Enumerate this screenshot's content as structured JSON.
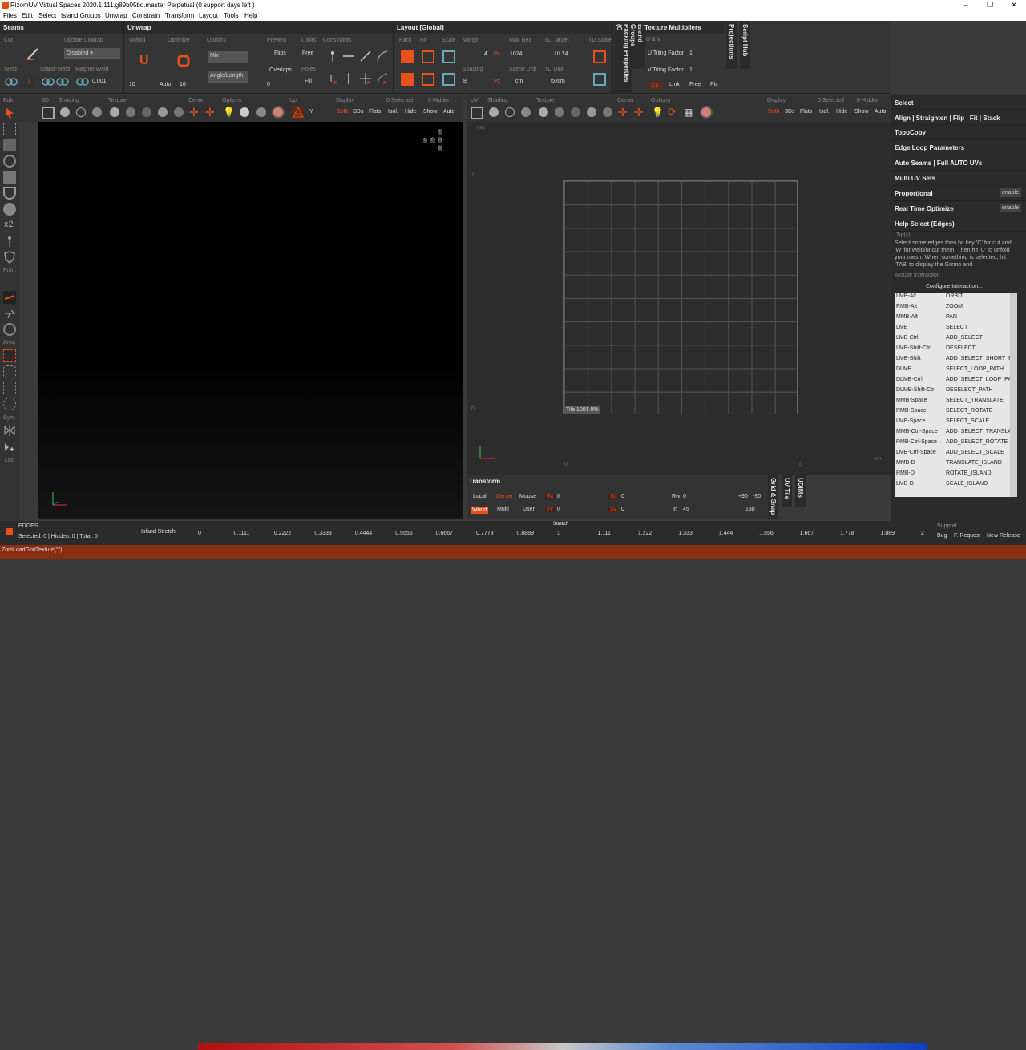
{
  "title": "RizomUV  Virtual Spaces 2020.1.111.g89b05bd.master Perpetual  (0 support days left )",
  "menu": [
    "Files",
    "Edit",
    "Select",
    "Island Groups",
    "Unwrap",
    "Constrain",
    "Transform",
    "Layout",
    "Tools",
    "Help"
  ],
  "seams": {
    "title": "Seams",
    "cut": "Cut",
    "update_unwrap": "Update Unwrap",
    "mode": "Disabled",
    "weld": "Weld",
    "island_weld": "Island-Weld",
    "magnet_weld": "Magnet-Weld",
    "magnet_value": "0.001"
  },
  "unwrap": {
    "title": "Unwrap",
    "unfold": "Unfold",
    "optimize": "Optimize",
    "options": "Options",
    "prevent": "Prevent",
    "limits": "Limits",
    "constraints": "Constraints",
    "mix": "Mix",
    "angle_length": "Angle/Length",
    "unfold_iter": "10",
    "optimize_iter": "10",
    "auto": "Auto",
    "flips": "Flips",
    "free": "Free",
    "overlaps": "Overlaps",
    "holes": "Holes",
    "overlaps_val": "0",
    "fill": "Fill"
  },
  "layout": {
    "title": "Layout [Global]",
    "pack": "Pack",
    "fit": "Fit",
    "scale": "Scale",
    "margin": "Margin",
    "margin_val": "4",
    "px": "Px",
    "map_rez": "Map Rez",
    "map_rez_val": "1024",
    "td_target": "TD Target",
    "td_target_val": "10.24",
    "td_scale": "TD Scale",
    "spacing": "Spacing",
    "spacing_val": "8",
    "scene_unit": "Scene Unit",
    "scene_unit_val": "cm",
    "td_unit": "TD Unit",
    "td_unit_val": "tx/cm"
  },
  "vtabs": {
    "island_groups": "Island Groups",
    "packing": "Packing Properties (C",
    "projections": "Projections",
    "script_hub": "Script Hub"
  },
  "texture": {
    "title": "Texture Multipliers",
    "uv": "U & V",
    "u_tiling": "U Tiling Factor",
    "u_val": "1",
    "v_tiling": "V Tiling Factor",
    "v_val": "1",
    "ratio": "1:1",
    "link": "Link",
    "free": "Free",
    "pic": "Pic"
  },
  "left_tools": {
    "edit": "Edit.",
    "prim": "Prim.",
    "area": "Area",
    "sym": "Sym.",
    "loc": "Loc",
    "x2": "x2"
  },
  "vp3d": {
    "labels": [
      "3D",
      "Shading",
      "Texture",
      "Center",
      "Options",
      "Up",
      "Display",
      "0 Selected",
      "0 Hidden"
    ],
    "up_val": "Y",
    "display": [
      "Both",
      "3Ds",
      "Flats",
      "Isol.",
      "Hide",
      "Show",
      "Auto"
    ],
    "cube": [
      "T",
      "L",
      "F",
      "R",
      "B"
    ]
  },
  "vpuv": {
    "labels": [
      "UV",
      "Shading",
      "Texture",
      "Center",
      "Options",
      "Display",
      "0 Selected",
      "0 Hidden"
    ],
    "display": [
      "Both",
      "3Ds",
      "Flats",
      "Isol.",
      "Hide",
      "Show",
      "Auto"
    ],
    "cm_top": "cm",
    "cm_right": "cm",
    "one": "1",
    "zero_v": "0",
    "zero_h": "0",
    "one_h": "1",
    "tile": "Tile 1001 0%"
  },
  "transform": {
    "title": "Transform",
    "local": "Local",
    "center": "Center",
    "mouse": "Mouse",
    "world": "World",
    "multi": "Multi",
    "user": "User",
    "tu": "Tu",
    "tv": "Tv",
    "su": "Su",
    "sv": "Sv",
    "rw": "Rw",
    "in": "In",
    "tu_val": "0",
    "tv_val": "0",
    "su_val": "0",
    "sv_val": "0",
    "rw_val": "0",
    "in_val": "45",
    "r1": "+90",
    "r2": "-90",
    "r3": "180"
  },
  "side_tabs": {
    "grid": "Grid & Snap",
    "uvtile": "UV Tile",
    "udims": "UDIMs"
  },
  "right_panel": {
    "sections": [
      "Select",
      "Align | Straighten | Flip | Fit | Stack",
      "TopoCopy",
      "Edge Loop Parameters",
      "Auto Seams | Full AUTO UVs",
      "Multi UV Sets",
      "Proportional",
      "Real Time Optimize",
      "Help Select (Edges)"
    ],
    "enable": "enable",
    "tips_label": "Tip(s)",
    "tips": "Select some edges then hit key 'C' for cut and 'W' for weld/uncut them. Then hit 'U' to unfold your mesh. When something is selected, hit 'TAB' to display the Gizmo and",
    "mouse_label": "Mouse Interaction",
    "configure": "Configure Interaction...",
    "bindings": [
      [
        "LMB-Alt",
        "ORBIT"
      ],
      [
        "RMB-Alt",
        "ZOOM"
      ],
      [
        "MMB-Alt",
        "PAN"
      ],
      [
        "LMB",
        "SELECT"
      ],
      [
        "LMB-Ctrl",
        "ADD_SELECT"
      ],
      [
        "LMB-Shift-Ctrl",
        "DESELECT"
      ],
      [
        "LMB-Shift",
        "ADD_SELECT_SHORT_PA"
      ],
      [
        "DLMB",
        "SELECT_LOOP_PATH"
      ],
      [
        "DLMB-Ctrl",
        "ADD_SELECT_LOOP_PA"
      ],
      [
        "DLMB-Shift-Ctrl",
        "DESELECT_PATH"
      ],
      [
        "MMB-Space",
        "SELECT_TRANSLATE"
      ],
      [
        "RMB-Space",
        "SELECT_ROTATE"
      ],
      [
        "LMB-Space",
        "SELECT_SCALE"
      ],
      [
        "MMB-Ctrl-Space",
        "ADD_SELECT_TRANSLAT"
      ],
      [
        "RMB-Ctrl-Space",
        "ADD_SELECT_ROTATE"
      ],
      [
        "LMB-Ctrl-Space",
        "ADD_SELECT_SCALE"
      ],
      [
        "MMB-D",
        "TRANSLATE_ISLAND"
      ],
      [
        "RMB-D",
        "ROTATE_ISLAND"
      ],
      [
        "LMB-D",
        "SCALE_ISLAND"
      ]
    ]
  },
  "status": {
    "mode": "EDGES",
    "counts": "Selected: 0 | Hidden: 0 | Total: 0",
    "island_stretch": "Island Stretch",
    "stretch": "Stretch",
    "ticks": [
      "0",
      "0.1111",
      "0.2222",
      "0.3333",
      "0.4444",
      "0.5556",
      "0.6667",
      "0.7778",
      "0.8889",
      "1",
      "1.111",
      "1.222",
      "1.333",
      "1.444",
      "1.556",
      "1.667",
      "1.778",
      "1.889",
      "2"
    ],
    "support": "Support",
    "bug": "Bug",
    "feature": "F. Request",
    "release": "New Release"
  },
  "cmdline": "ZomLoadGridTexture(\"\")"
}
